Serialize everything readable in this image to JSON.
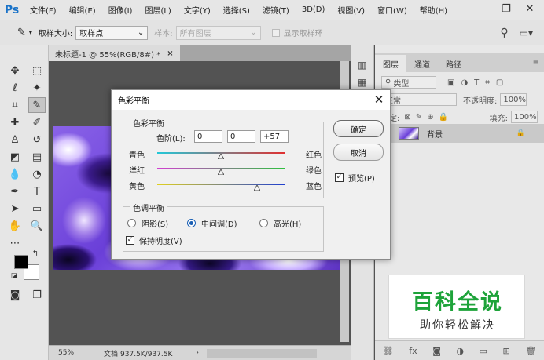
{
  "app": {
    "logo": "Ps"
  },
  "menu": [
    "文件(F)",
    "编辑(E)",
    "图像(I)",
    "图层(L)",
    "文字(Y)",
    "选择(S)",
    "滤镜(T)",
    "3D(D)",
    "视图(V)",
    "窗口(W)",
    "帮助(H)"
  ],
  "window_controls": {
    "minimize": "—",
    "restore": "❐",
    "close": "✕"
  },
  "options": {
    "sample_size_label": "取样大小:",
    "sample_size_value": "取样点",
    "sample_label": "样本:",
    "sample_value": "所有图层",
    "show_ring_label": "显示取样环"
  },
  "document": {
    "tab_title": "未标题-1 @ 55%(RGB/8#) *",
    "tab_close": "×",
    "zoom": "55%",
    "doc_info": "文档:937.5K/937.5K"
  },
  "layers_panel": {
    "tabs": [
      "图层",
      "通道",
      "路径"
    ],
    "filter_kind": "类型",
    "blend_mode": "正常",
    "opacity_label": "不透明度:",
    "opacity_value": "100%",
    "lock_label": "锁定:",
    "fill_label": "填充:",
    "fill_value": "100%",
    "layer_name": "背景"
  },
  "watermark": {
    "title": "百科全说",
    "subtitle": "助你轻松解决"
  },
  "dialog": {
    "title": "色彩平衡",
    "close": "✕",
    "balance_group": "色彩平衡",
    "levels_label": "色阶(L):",
    "levels": [
      "0",
      "0",
      "+57"
    ],
    "sliders": [
      {
        "left": "青色",
        "right": "红色",
        "value": 0,
        "from": "#22c8d8",
        "to": "#e03030"
      },
      {
        "left": "洋红",
        "right": "绿色",
        "value": 0,
        "from": "#d040d0",
        "to": "#30c040"
      },
      {
        "left": "黄色",
        "right": "蓝色",
        "value": 57,
        "from": "#e0d020",
        "to": "#2040d0"
      }
    ],
    "tone_group": "色调平衡",
    "tones": [
      "阴影(S)",
      "中间调(D)",
      "高光(H)"
    ],
    "selected_tone": "中间调(D)",
    "preserve_label": "保持明度(V)",
    "preserve_checked": true,
    "ok_label": "确定",
    "cancel_label": "取消",
    "preview_label": "预览(P)",
    "preview_checked": true
  }
}
